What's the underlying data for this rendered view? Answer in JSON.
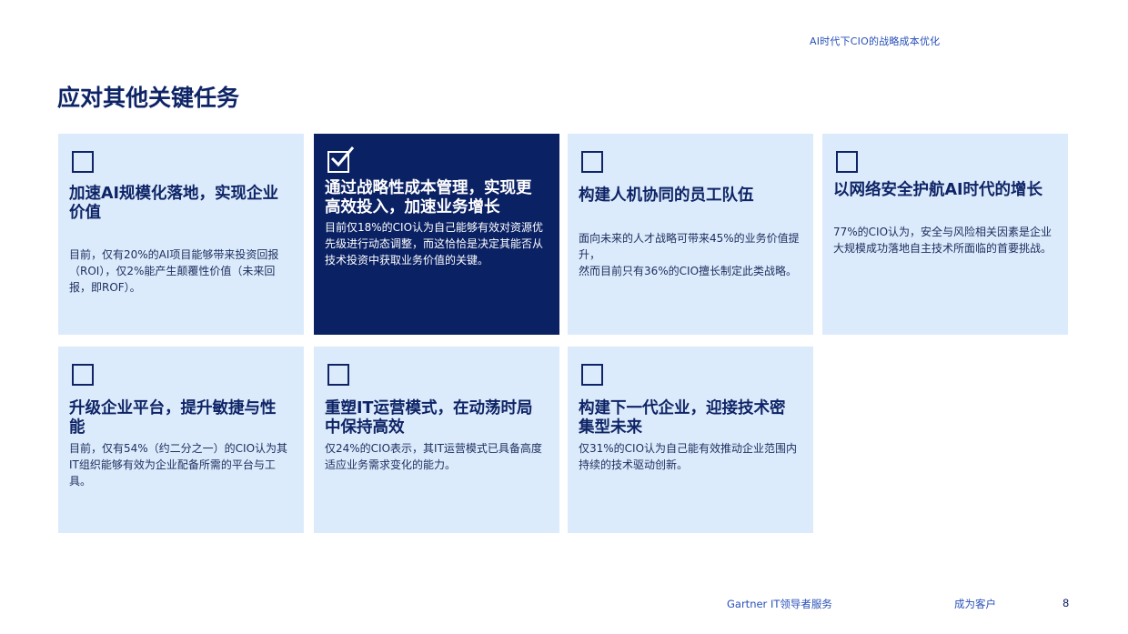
{
  "header": {
    "report_title": "AI时代下CIO的战略成本优化"
  },
  "page": {
    "title": "应对其他关键任务"
  },
  "cards": [
    {
      "title": "加速AI规模化落地，实现企业价值",
      "body": "目前，仅有20%的AI项目能够带来投资回报（ROI），仅2%能产生颠覆性价值（未来回报，即ROF）。",
      "checked": false
    },
    {
      "title": "通过战略性成本管理，实现更高效投入，加速业务增长",
      "body": "目前仅18%的CIO认为自己能够有效对资源优先级进行动态调整，而这恰恰是决定其能否从技术投资中获取业务价值的关键。",
      "checked": true
    },
    {
      "title": "构建人机协同的员工队伍",
      "body": "面向未来的人才战略可带来45%的业务价值提升，\n然而目前只有36%的CIO擅长制定此类战略。",
      "checked": false
    },
    {
      "title": "以网络安全护航AI时代的增长",
      "body": "77%的CIO认为，安全与风险相关因素是企业大规模成功落地自主技术所面临的首要挑战。",
      "checked": false
    },
    {
      "title": "升级企业平台，提升敏捷与性能",
      "body": "目前，仅有54%（约二分之一）的CIO认为其IT组织能够有效为企业配备所需的平台与工具。",
      "checked": false
    },
    {
      "title": "重塑IT运营模式，在动荡时局中保持高效",
      "body": "仅24%的CIO表示，其IT运营模式已具备高度适应业务需求变化的能力。",
      "checked": false
    },
    {
      "title": "构建下一代企业，迎接技术密集型未来",
      "body": "仅31%的CIO认为自己能有效推动企业范围内持续的技术驱动创新。",
      "checked": false
    }
  ],
  "footer": {
    "brand": "Gartner IT领导者服务",
    "cta": "成为客户",
    "page_number": "8"
  },
  "colors": {
    "card_bg": "#dcebfb",
    "card_selected_bg": "#0a2164",
    "title_navy": "#0e2466",
    "accent_blue": "#2850b8"
  },
  "icons": {
    "checkbox": "checkbox-icon",
    "checkbox_checked": "checkbox-checked-icon"
  }
}
